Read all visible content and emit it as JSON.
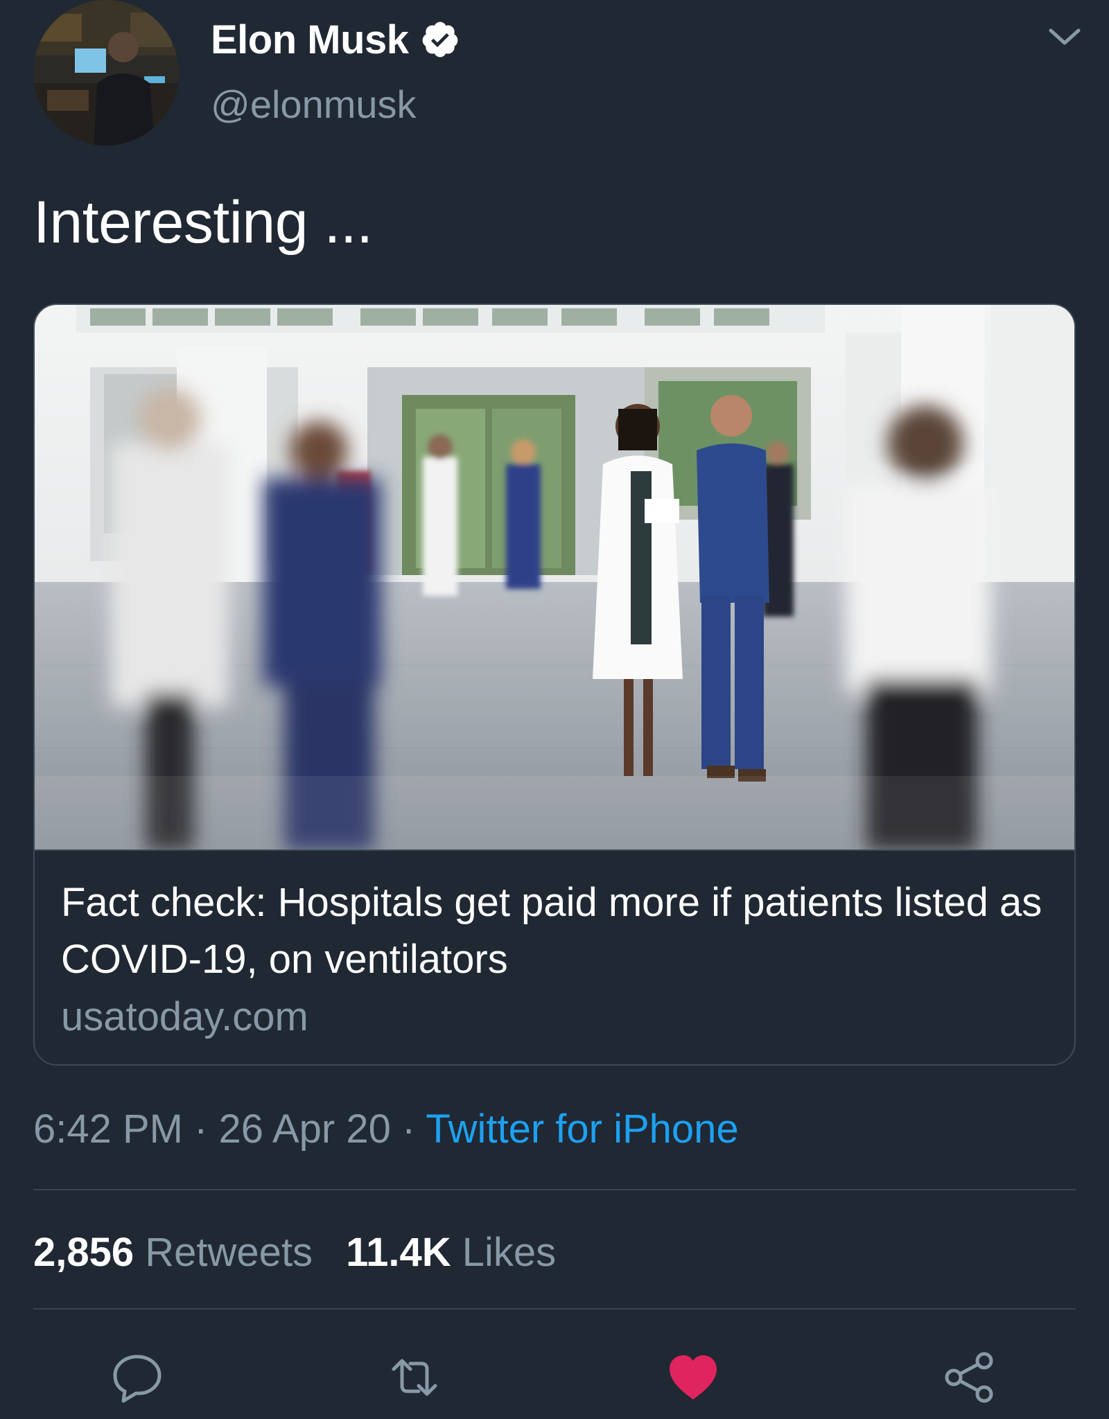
{
  "user": {
    "display_name": "Elon Musk",
    "handle": "@elonmusk",
    "verified": true
  },
  "tweet": {
    "text": "Interesting ..."
  },
  "card": {
    "title": "Fact check: Hospitals get paid more if patients listed as COVID-19, on ventilators",
    "domain": "usatoday.com"
  },
  "meta": {
    "time": "6:42 PM",
    "separator": " · ",
    "date": "26 Apr 20",
    "source": "Twitter for iPhone"
  },
  "stats": {
    "retweets_count": "2,856",
    "retweets_label": "Retweets",
    "likes_count": "11.4K",
    "likes_label": "Likes"
  },
  "actions": {
    "reply_icon": "reply-icon",
    "retweet_icon": "retweet-icon",
    "like_icon": "heart-icon",
    "share_icon": "share-icon"
  },
  "colors": {
    "background": "#202833",
    "secondary_text": "#8899a6",
    "link": "#1da1f2",
    "like": "#e0245e",
    "divider": "#38444d"
  }
}
